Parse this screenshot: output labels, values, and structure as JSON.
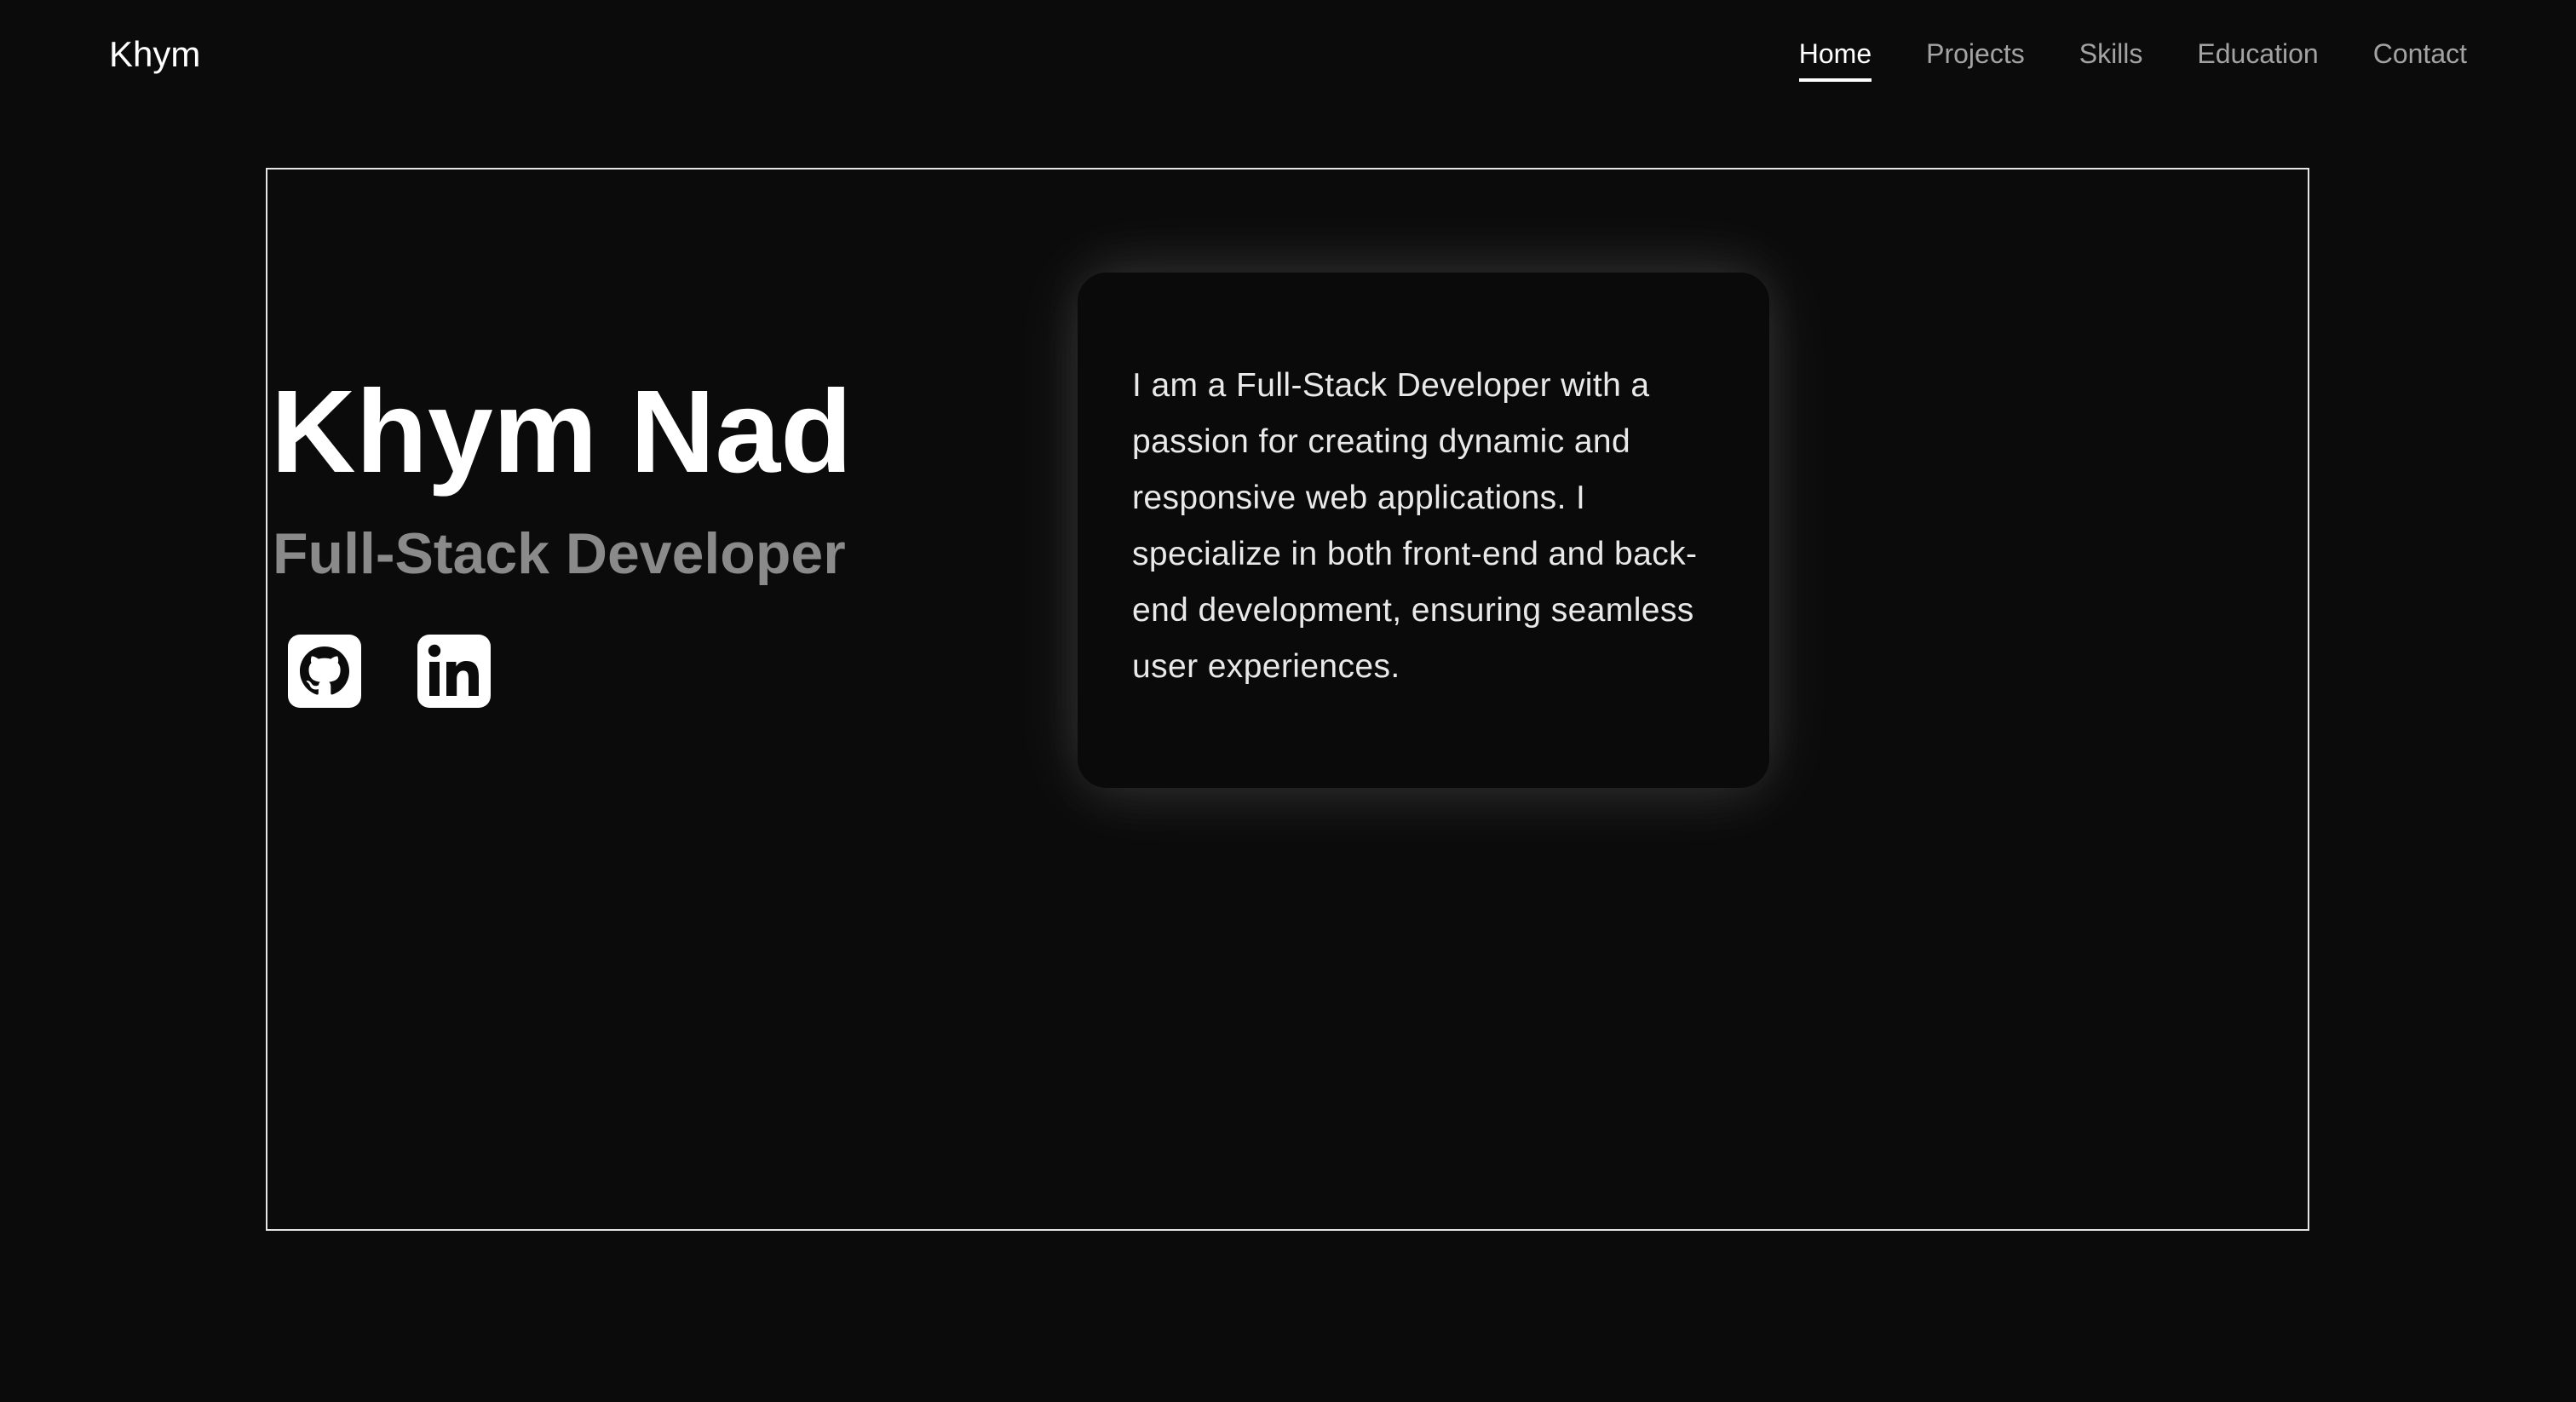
{
  "brand": "Khym",
  "nav": {
    "items": [
      {
        "label": "Home"
      },
      {
        "label": "Projects"
      },
      {
        "label": "Skills"
      },
      {
        "label": "Education"
      },
      {
        "label": "Contact"
      }
    ],
    "active": "Home"
  },
  "hero": {
    "name": "Khym Nad",
    "role": "Full-Stack Developer",
    "socials": [
      {
        "icon": "github-icon"
      },
      {
        "icon": "linkedin-icon"
      }
    ]
  },
  "about": {
    "text": "I am a Full-Stack Developer with a passion for creating dynamic and responsive web applications. I specialize in both front-end and back-end development, ensuring seamless user experiences."
  },
  "colors": {
    "background": "#0b0b0b",
    "text_primary": "#ffffff",
    "text_muted": "#a3a3a3",
    "role_gray": "#8a8a8a",
    "frame_border": "#e5e5e5"
  }
}
